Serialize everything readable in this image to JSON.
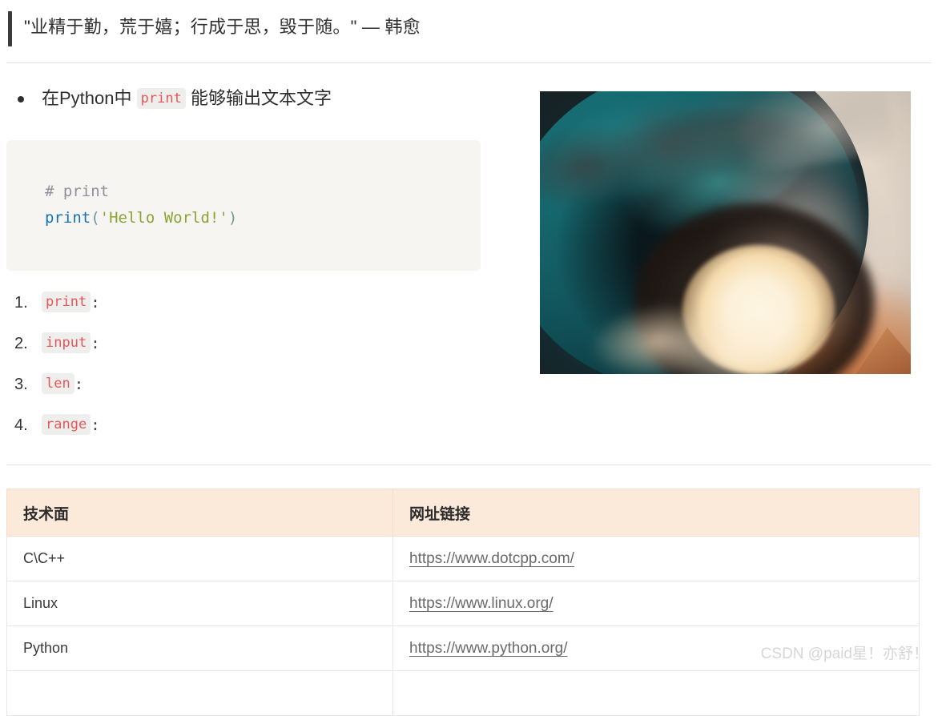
{
  "blockquote": {
    "text": "\"业精于勤，荒于嬉；行成于思，毁于随。\" — 韩愈"
  },
  "bullet_list": [
    {
      "prefix": "在Python中",
      "code": "print",
      "suffix": "能够输出文本文字"
    }
  ],
  "code_block": {
    "language": "python",
    "lines": [
      {
        "comment": "# print"
      },
      {
        "func": "print",
        "open": "(",
        "string": "'Hello World!'",
        "close": ")"
      }
    ]
  },
  "ordered_list": [
    {
      "num": "1.",
      "code": "print",
      "colon": ":"
    },
    {
      "num": "2.",
      "code": "input",
      "colon": ":"
    },
    {
      "num": "3.",
      "code": "len",
      "colon": ":"
    },
    {
      "num": "4.",
      "code": "range",
      "colon": ":"
    }
  ],
  "hero_image": {
    "alt": "ocean-wave-barrel-at-sunset"
  },
  "table": {
    "headers": [
      "技术面",
      "网址链接"
    ],
    "rows": [
      {
        "tech": "C\\C++",
        "url": "https://www.dotcpp.com/"
      },
      {
        "tech": "Linux",
        "url": "https://www.linux.org/"
      },
      {
        "tech": "Python",
        "url": "https://www.python.org/"
      }
    ]
  },
  "watermark": {
    "text": "CSDN @paid星！亦舒！"
  },
  "colors": {
    "accent_code": "#e8565a",
    "code_chip_bg": "#eeeeec",
    "code_block_bg": "#f6f5f1",
    "table_header_bg": "#fbe9da",
    "quote_bar": "#3b3b3b",
    "link": "#6a6a6a",
    "watermark": "#d6d6d6"
  }
}
